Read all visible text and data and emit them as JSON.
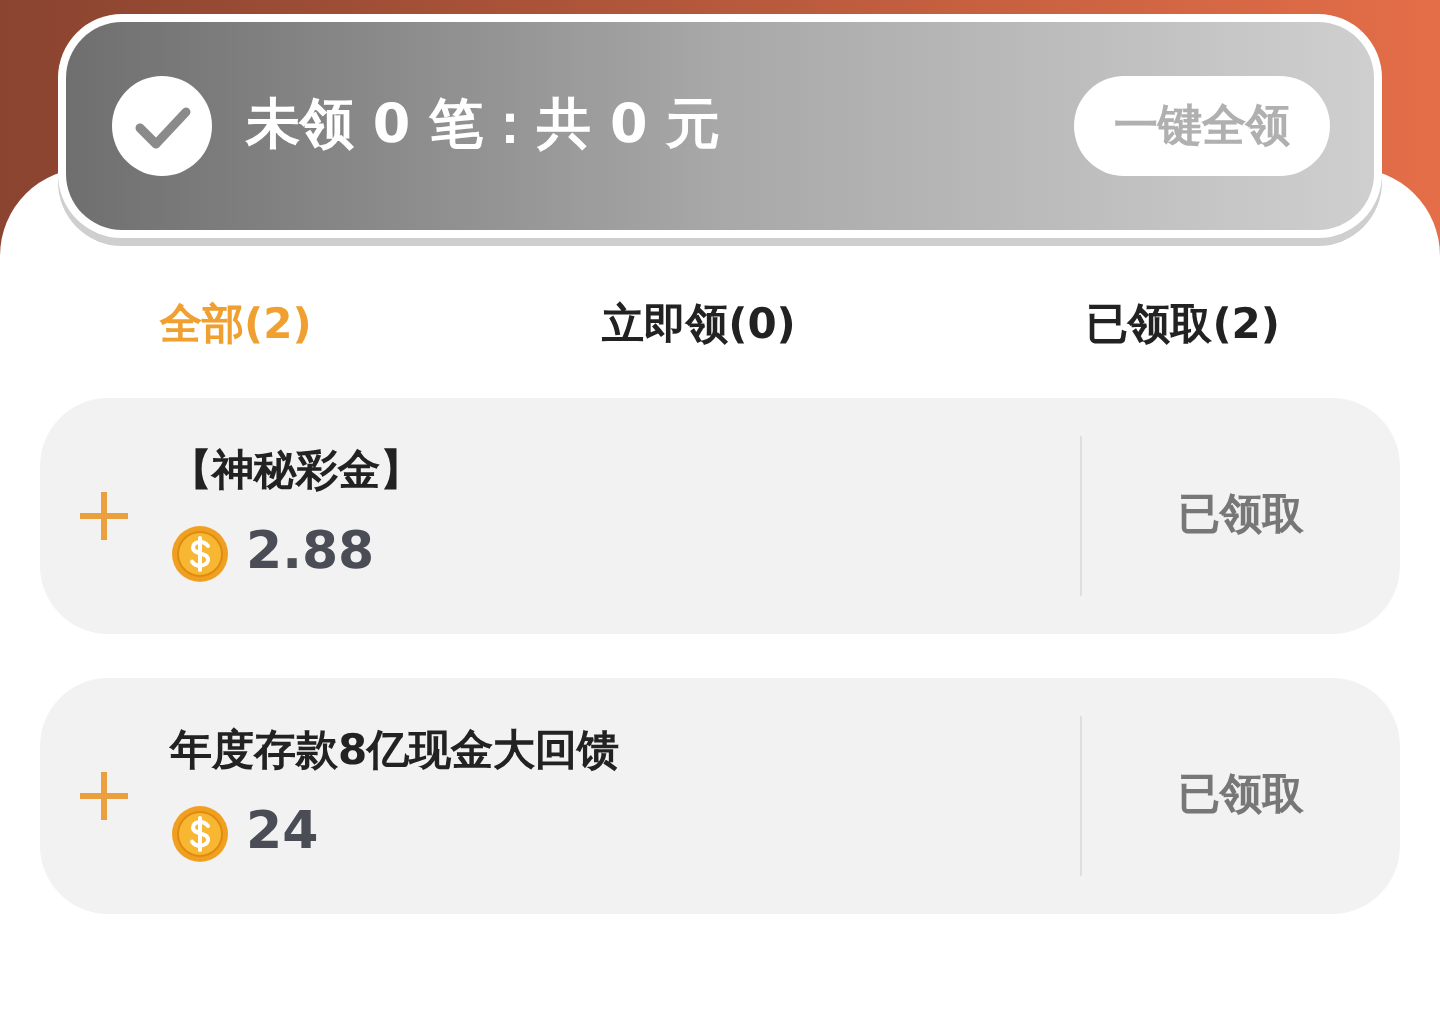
{
  "summary": {
    "text": "未领 0 笔：共 0 元",
    "claim_all_button": "一键全领",
    "all_claimed": true
  },
  "tabs": [
    {
      "label": "全部(2)",
      "selected": true
    },
    {
      "label": "立即领(0)",
      "selected": false
    },
    {
      "label": "已领取(2)",
      "selected": false
    }
  ],
  "rewards": [
    {
      "title": "【神秘彩金】",
      "amount": "2.88",
      "status": "已领取",
      "claimed": true
    },
    {
      "title": "年度存款8亿现金大回馈",
      "amount": "24",
      "status": "已领取",
      "claimed": true
    }
  ]
}
